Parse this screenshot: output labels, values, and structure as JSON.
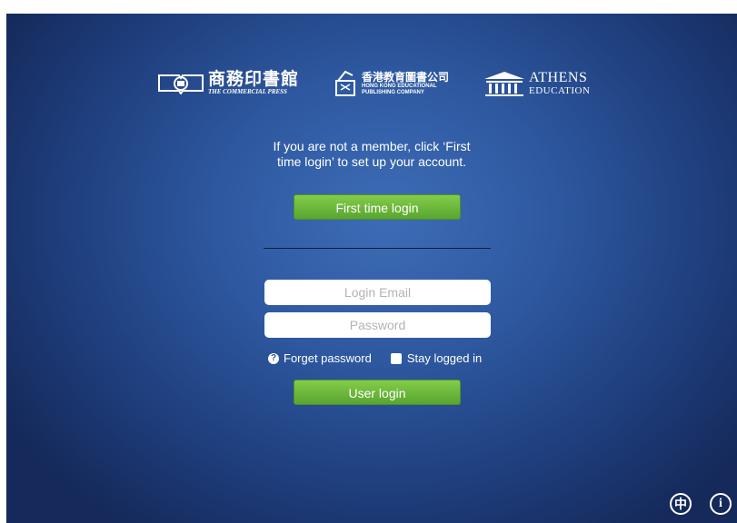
{
  "logos": {
    "commercial_press": {
      "cn": "商務印書館",
      "en": "THE COMMERCIAL PRESS"
    },
    "hk_educational": {
      "cn": "香港教育圖書公司",
      "en_line1": "HONG KONG EDUCATIONAL",
      "en_line2": "PUBLISHING COMPANY"
    },
    "athens": {
      "line1": "ATHENS",
      "line2": "EDUCATION"
    }
  },
  "message": {
    "line1": "If you are not a member, click ‘First",
    "line2": "time login’ to set up your account."
  },
  "first_login_button": "First time login",
  "email_field": {
    "placeholder": "Login Email",
    "value": ""
  },
  "password_field": {
    "placeholder": "Password",
    "value": ""
  },
  "forget_password_label": "Forget password",
  "stay_logged_in_label": "Stay logged in",
  "stay_logged_in_checked": false,
  "user_login_button": "User login",
  "corner_icons": {
    "language": "中",
    "info": "i"
  },
  "colors": {
    "accent_green": "#6cbb3c",
    "background_blue": "#2f5aa2"
  }
}
